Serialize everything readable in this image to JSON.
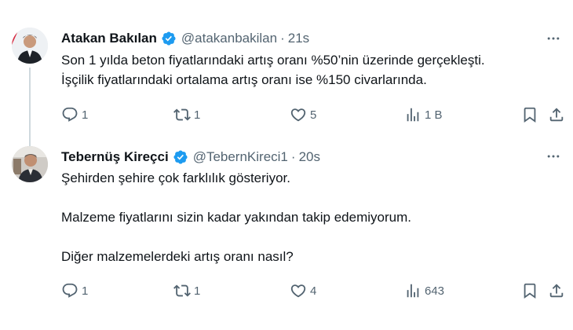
{
  "tweets": [
    {
      "author_name": "Atakan Bakılan",
      "handle": "@atakanbakilan",
      "separator": "·",
      "time": "21s",
      "lines": [
        "Son 1 yılda beton fiyatlarındaki artış oranı %50’nin üzerinde gerçekleşti.",
        "İşçilik fiyatlarındaki ortalama artış oranı ise %150 civarlarında."
      ],
      "replies": "1",
      "retweets": "1",
      "likes": "5",
      "views": "1 B"
    },
    {
      "author_name": "Tebernüş Kireçci",
      "handle": "@TebernKireci1",
      "separator": "·",
      "time": "20s",
      "lines": [
        "Şehirden şehire çok farklılık gösteriyor.",
        "Malzeme fiyatlarını sizin kadar yakından takip edemiyorum.",
        "Diğer malzemelerdeki artış oranı nasıl?"
      ],
      "replies": "1",
      "retweets": "1",
      "likes": "4",
      "views": "643"
    }
  ],
  "icons": {
    "verified": "verified-badge-icon",
    "more": "more-options-icon",
    "reply": "reply-icon",
    "retweet": "retweet-icon",
    "like": "heart-icon",
    "views": "views-icon",
    "bookmark": "bookmark-icon",
    "share": "share-icon"
  },
  "colors": {
    "text": "#0f1419",
    "secondary": "#536471",
    "verified": "#1d9bf0",
    "thread_line": "#cfd9de"
  }
}
